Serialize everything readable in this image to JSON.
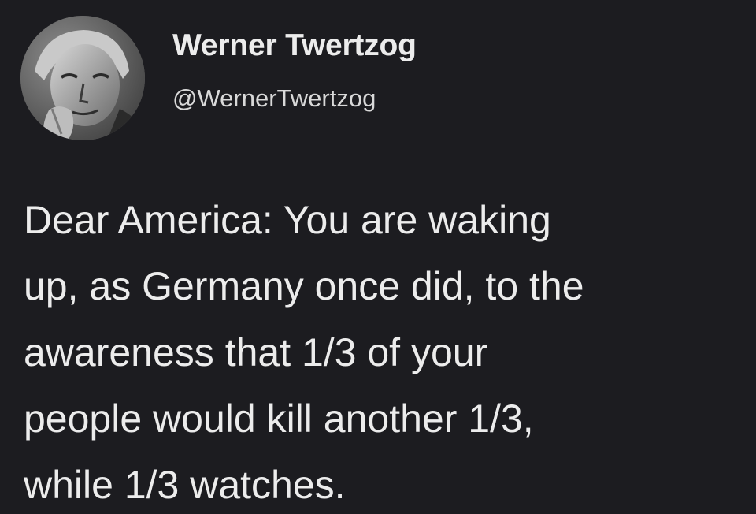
{
  "tweet": {
    "author": {
      "display_name": "Werner Twertzog",
      "handle": "@WernerTwertzog",
      "avatar_icon": "profile-photo"
    },
    "text_lines": [
      "Dear America: You are waking",
      "up, as Germany once did, to the",
      "awareness that 1/3 of your",
      "people would kill another 1/3,",
      "while 1/3 watches."
    ]
  },
  "colors": {
    "background": "#1c1c20",
    "text": "#ececec",
    "handle_text": "#d9d9d9"
  }
}
